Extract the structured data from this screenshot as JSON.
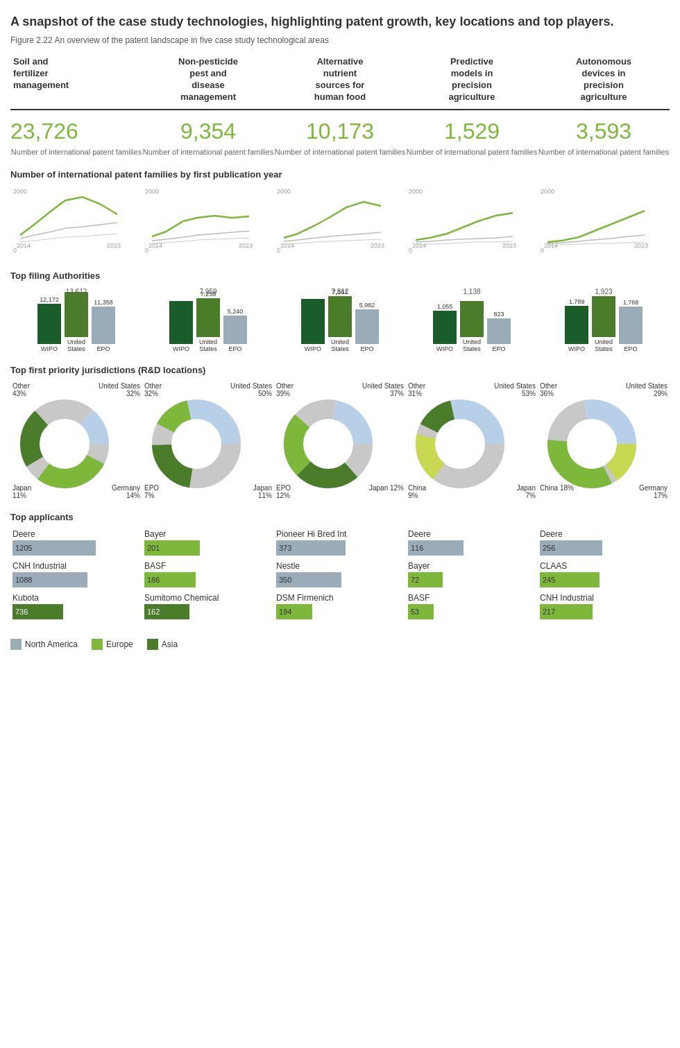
{
  "title": "A snapshot of the case study technologies, highlighting patent growth, key locations and top players.",
  "subtitle": "Figure 2.22 An overview of the patent landscape in five case study technological areas",
  "columns": [
    {
      "header": "Soil and fertilizer management",
      "number": "23,726",
      "number_label": "Number of international patent families",
      "filing_bars": [
        {
          "label": "WIPO",
          "value": 12172,
          "color": "dark"
        },
        {
          "label": "United States",
          "value": 13612,
          "color": "mid"
        },
        {
          "label": "EPO",
          "value": 11358,
          "color": "gray"
        }
      ],
      "filing_max": 14000,
      "donut": {
        "segments": [
          {
            "label": "Other",
            "pct": 43,
            "color": "#c8c8c8"
          },
          {
            "label": "United States",
            "pct": 32,
            "color": "#b8cfe8"
          },
          {
            "label": "Germany",
            "pct": 14,
            "color": "#7db83a"
          },
          {
            "label": "Japan",
            "pct": 11,
            "color": "#4a7c2a"
          }
        ],
        "top_left": "Other\n43%",
        "top_right": "United States\n32%",
        "bot_left": "Japan\n11%",
        "bot_right": "Germany\n14%"
      },
      "applicants": [
        {
          "name": "Deere",
          "value": 1205,
          "color": "#9aacb8",
          "width": 120
        },
        {
          "name": "CNH Industrial",
          "value": 1088,
          "color": "#9aacb8",
          "width": 108
        },
        {
          "name": "Kubota",
          "value": 736,
          "color": "#4a7c2a",
          "width": 73
        }
      ]
    },
    {
      "header": "Non-pesticide pest and disease management",
      "number": "9,354",
      "number_label": "Number of international patent families",
      "filing_bars": [
        {
          "label": "WIPO",
          "value": 7959,
          "color": "dark"
        },
        {
          "label": "United States",
          "value": 7258,
          "color": "mid"
        },
        {
          "label": "EPO",
          "value": 5240,
          "color": "gray"
        }
      ],
      "filing_max": 9000,
      "donut": {
        "segments": [
          {
            "label": "Other",
            "pct": 32,
            "color": "#c8c8c8"
          },
          {
            "label": "United States",
            "pct": 50,
            "color": "#b8cfe8"
          },
          {
            "label": "Japan",
            "pct": 11,
            "color": "#4a7c2a"
          },
          {
            "label": "EPO",
            "pct": 7,
            "color": "#7db83a"
          }
        ],
        "top_left": "Other\n32%",
        "top_right": "United States\n50%",
        "bot_left": "EPO\n7%",
        "bot_right": "Japan\n11%"
      },
      "applicants": [
        {
          "name": "Bayer",
          "value": 201,
          "color": "#7db83a",
          "width": 90
        },
        {
          "name": "BASF",
          "value": 186,
          "color": "#7db83a",
          "width": 83
        },
        {
          "name": "Sumitomo Chemical",
          "value": 162,
          "color": "#4a7c2a",
          "width": 72
        }
      ]
    },
    {
      "header": "Alternative nutrient sources for human food",
      "number": "10,173",
      "number_label": "Number of international patent families",
      "filing_bars": [
        {
          "label": "WIPO",
          "value": 7812,
          "color": "dark"
        },
        {
          "label": "United States",
          "value": 7161,
          "color": "mid"
        },
        {
          "label": "EPO",
          "value": 5982,
          "color": "gray"
        }
      ],
      "filing_max": 9000,
      "donut": {
        "segments": [
          {
            "label": "Other",
            "pct": 39,
            "color": "#c8c8c8"
          },
          {
            "label": "United States",
            "pct": 37,
            "color": "#b8cfe8"
          },
          {
            "label": "Japan",
            "pct": 12,
            "color": "#4a7c2a"
          },
          {
            "label": "EPO",
            "pct": 12,
            "color": "#7db83a"
          }
        ],
        "top_left": "Other\n39%",
        "top_right": "United States\n37%",
        "bot_left": "EPO\n12%",
        "bot_right": "Japan 12%"
      },
      "applicants": [
        {
          "name": "Pioneer Hi Bred Int",
          "value": 373,
          "color": "#9aacb8",
          "width": 100
        },
        {
          "name": "Nestle",
          "value": 350,
          "color": "#9aacb8",
          "width": 94
        },
        {
          "name": "DSM Firmenich",
          "value": 194,
          "color": "#7db83a",
          "width": 52
        }
      ]
    },
    {
      "header": "Predictive models in precision agriculture",
      "number": "1,529",
      "number_label": "Number of international patent families",
      "filing_bars": [
        {
          "label": "WIPO",
          "value": 1055,
          "color": "dark"
        },
        {
          "label": "United States",
          "value": 1138,
          "color": "mid"
        },
        {
          "label": "EPO",
          "value": 823,
          "color": "gray"
        }
      ],
      "filing_max": 1400,
      "donut": {
        "segments": [
          {
            "label": "Other",
            "pct": 31,
            "color": "#c8c8c8"
          },
          {
            "label": "United States",
            "pct": 53,
            "color": "#b8cfe8"
          },
          {
            "label": "Japan",
            "pct": 7,
            "color": "#4a7c2a"
          },
          {
            "label": "China",
            "pct": 9,
            "color": "#c8d850"
          }
        ],
        "top_left": "Other\n31%",
        "top_right": "United States\n53%",
        "bot_left": "China\n9%",
        "bot_right": "Japan\n7%"
      },
      "applicants": [
        {
          "name": "Deere",
          "value": 116,
          "color": "#9aacb8",
          "width": 80
        },
        {
          "name": "Bayer",
          "value": 72,
          "color": "#7db83a",
          "width": 50
        },
        {
          "name": "BASF",
          "value": 53,
          "color": "#7db83a",
          "width": 37
        }
      ]
    },
    {
      "header": "Autonomous devices in precision agriculture",
      "number": "3,593",
      "number_label": "Number of international patent families",
      "filing_bars": [
        {
          "label": "WIPO",
          "value": 1789,
          "color": "dark"
        },
        {
          "label": "United States",
          "value": 1923,
          "color": "mid"
        },
        {
          "label": "EPO",
          "value": 1768,
          "color": "gray"
        }
      ],
      "filing_max": 2200,
      "donut": {
        "segments": [
          {
            "label": "Other",
            "pct": 36,
            "color": "#c8c8c8"
          },
          {
            "label": "United States",
            "pct": 29,
            "color": "#b8cfe8"
          },
          {
            "label": "Germany",
            "pct": 17,
            "color": "#7db83a"
          },
          {
            "label": "China",
            "pct": 18,
            "color": "#c8d850"
          }
        ],
        "top_left": "Other\n36%",
        "top_right": "United States\n29%",
        "bot_left": "China 18%",
        "bot_right": "Germany\n17%"
      },
      "applicants": [
        {
          "name": "Deere",
          "value": 256,
          "color": "#9aacb8",
          "width": 90
        },
        {
          "name": "CLAAS",
          "value": 245,
          "color": "#7db83a",
          "width": 86
        },
        {
          "name": "CNH Industrial",
          "value": 217,
          "color": "#7db83a",
          "width": 76
        }
      ]
    }
  ],
  "section_titles": {
    "patent_families": "Number of international patent families by first publication year",
    "filing_authorities": "Top filing Authorities",
    "jurisdictions": "Top first priority jurisdictions (R&D locations)",
    "applicants": "Top applicants"
  },
  "legend": [
    {
      "label": "North America",
      "color": "#9aacb8"
    },
    {
      "label": "Europe",
      "color": "#7db83a"
    },
    {
      "label": "Asia",
      "color": "#4a7c2a"
    }
  ],
  "chart_years": {
    "start": "2014",
    "end": "2023",
    "top": "2000",
    "zero": "0"
  }
}
